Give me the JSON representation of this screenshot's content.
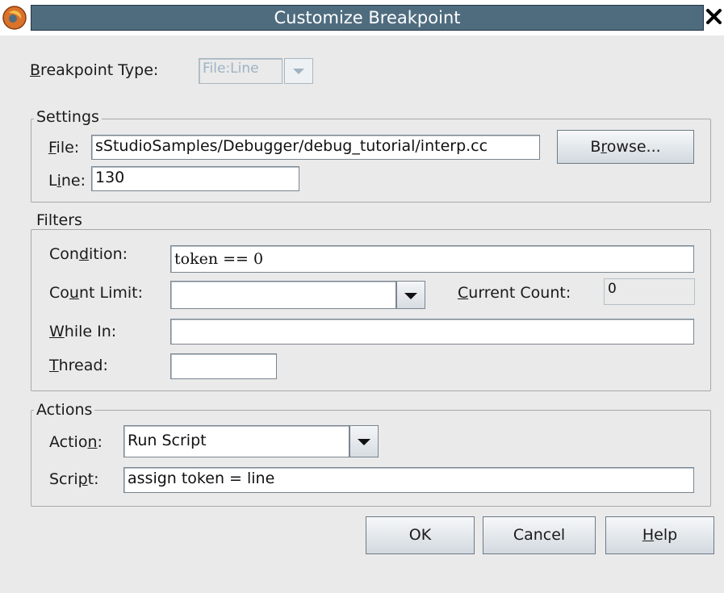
{
  "window": {
    "title": "Customize Breakpoint",
    "app_icon": "firefox-style-app-icon",
    "close_icon": "close-x-icon"
  },
  "breakpoint_type": {
    "label_accel": "B",
    "label_rest": "reakpoint Type:",
    "value": "File:Line",
    "disabled": true
  },
  "settings": {
    "title": "Settings",
    "file": {
      "label_accel": "F",
      "label_rest": "ile:",
      "value": "sStudioSamples/Debugger/debug_tutorial/interp.cc"
    },
    "browse": {
      "pre": "B",
      "accel": "r",
      "post": "owse..."
    },
    "line": {
      "label_pre": "L",
      "label_accel": "i",
      "label_post": "ne:",
      "value": "130"
    }
  },
  "filters": {
    "title": "Filters",
    "condition": {
      "label_pre": "Con",
      "label_accel": "d",
      "label_post": "ition:",
      "value": "token == 0"
    },
    "count_limit": {
      "label_pre": "Co",
      "label_accel": "u",
      "label_post": "nt Limit:",
      "value": ""
    },
    "current_count": {
      "label_accel": "C",
      "label_rest": "urrent Count:",
      "value": "0"
    },
    "while_in": {
      "label_accel": "W",
      "label_rest": "hile In:",
      "value": ""
    },
    "thread": {
      "label_accel": "T",
      "label_rest": "hread:",
      "value": ""
    }
  },
  "actions": {
    "title": "Actions",
    "action": {
      "label_pre": "Actio",
      "label_accel": "n",
      "label_post": ":",
      "value": "Run Script"
    },
    "script": {
      "label_pre": "Scri",
      "label_accel": "p",
      "label_post": "t:",
      "value": "assign token = line"
    }
  },
  "buttons": {
    "ok": "OK",
    "cancel": "Cancel",
    "help_accel": "H",
    "help_rest": "elp"
  }
}
